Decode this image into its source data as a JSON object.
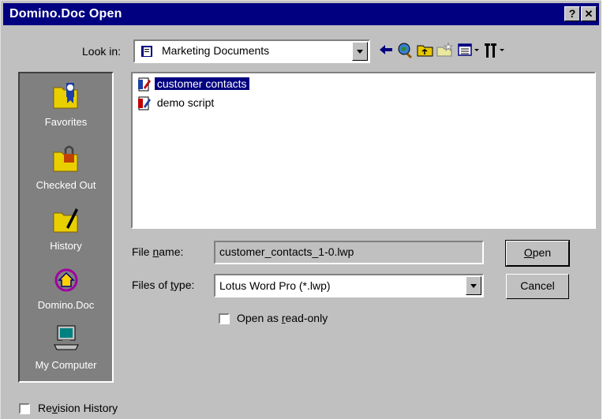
{
  "window": {
    "title": "Domino.Doc Open",
    "help_label": "?",
    "close_label": "✕"
  },
  "lookin": {
    "label": "Look in:",
    "value": "Marketing Documents",
    "toolbar_icons": [
      "back-arrow-icon",
      "search-web-icon",
      "up-folder-icon",
      "new-folder-icon",
      "view-menu-icon",
      "tools-menu-icon"
    ]
  },
  "places": [
    {
      "label": "Favorites",
      "icon": "favorites-folder-icon"
    },
    {
      "label": "Checked Out",
      "icon": "checked-out-folder-icon"
    },
    {
      "label": "History",
      "icon": "history-folder-icon"
    },
    {
      "label": "Domino.Doc",
      "icon": "domino-doc-icon"
    },
    {
      "label": "My Computer",
      "icon": "my-computer-icon"
    }
  ],
  "files": [
    {
      "name": "customer contacts",
      "selected": true
    },
    {
      "name": "demo script",
      "selected": false
    }
  ],
  "filename": {
    "label_pre": "File ",
    "label_u": "n",
    "label_post": "ame:",
    "value": "customer_contacts_1-0.lwp"
  },
  "filetype": {
    "label_pre": "Files of ",
    "label_u": "t",
    "label_post": "ype:",
    "value": "Lotus Word Pro (*.lwp)"
  },
  "readonly": {
    "label_pre": "Open as ",
    "label_u": "r",
    "label_post": "ead-only",
    "checked": false
  },
  "buttons": {
    "open_u": "O",
    "open_rest": "pen",
    "cancel": "Cancel"
  },
  "revision": {
    "label_pre": "Re",
    "label_u": "v",
    "label_post": "ision History",
    "checked": false
  }
}
